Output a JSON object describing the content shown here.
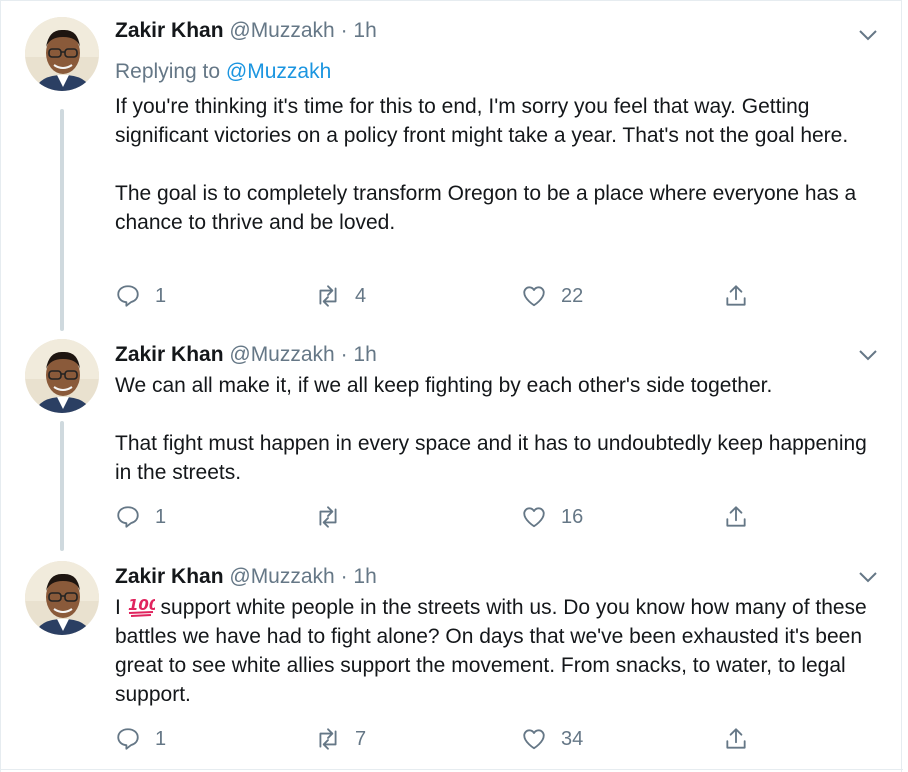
{
  "tweets": [
    {
      "name": "Zakir Khan",
      "handle": "@Muzzakh",
      "dot": "·",
      "time": "1h",
      "replying_prefix": "Replying to ",
      "replying_handle": "@Muzzakh",
      "text": "If you're thinking it's time for this to end, I'm sorry you feel that way. Getting significant victories on a policy front might take a year. That's not the goal here.\n\nThe goal is to completely transform Oregon to be a place where everyone has a chance to thrive and be loved.",
      "replies": "1",
      "retweets": "4",
      "likes": "22"
    },
    {
      "name": "Zakir Khan",
      "handle": "@Muzzakh",
      "dot": "·",
      "time": "1h",
      "text": "We can all make it, if we all keep fighting by each other's side together.\n\nThat fight must happen in every space and it has to undoubtedly keep happening in the streets.",
      "replies": "1",
      "retweets": "",
      "likes": "16"
    },
    {
      "name": "Zakir Khan",
      "handle": "@Muzzakh",
      "dot": "·",
      "time": "1h",
      "text_prefix": "I",
      "emoji": "hundred-points-emoji",
      "text_rest": " support white people in the streets with us. Do you know how many of these battles we have had to fight alone? On days that we've been exhausted it's been great to see white allies support the movement. From snacks, to water, to legal support.",
      "replies": "1",
      "retweets": "7",
      "likes": "34"
    }
  ],
  "icons": {
    "reply": "reply-icon",
    "retweet": "retweet-icon",
    "like": "heart-icon",
    "share": "share-icon",
    "caret": "chevron-down-icon"
  },
  "colors": {
    "link": "#1b95e0",
    "secondary": "#657786",
    "thread": "#cfd9de"
  }
}
